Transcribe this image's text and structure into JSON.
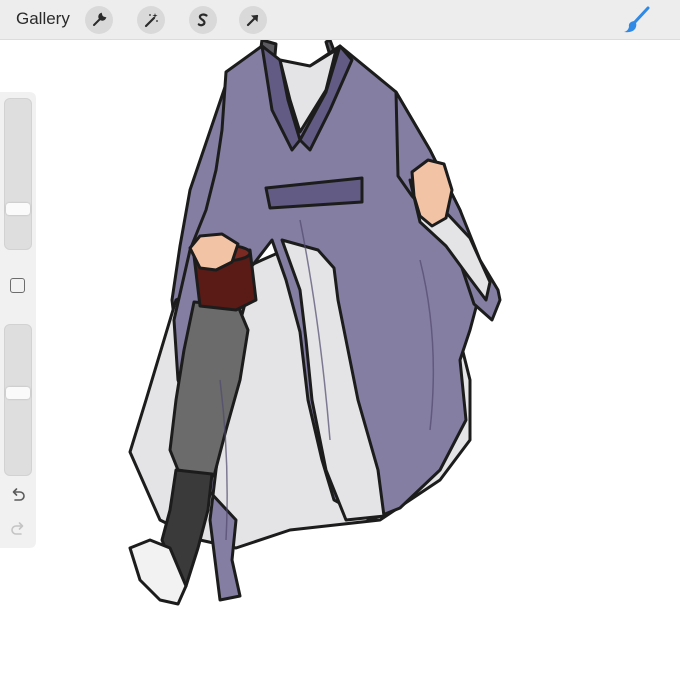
{
  "app": {
    "gallery_label": "Gallery"
  },
  "toolbar": {
    "left_tools": [
      {
        "name": "actions",
        "icon": "wrench-icon"
      },
      {
        "name": "adjustments",
        "icon": "magic-wand-icon"
      },
      {
        "name": "selection",
        "icon": "selection-s-icon"
      },
      {
        "name": "transform",
        "icon": "arrow-cursor-icon"
      }
    ],
    "right_tools": [
      {
        "name": "brush",
        "icon": "brush-icon",
        "active": true
      }
    ]
  },
  "sidebar": {
    "brush_size_level": 0.25,
    "opacity_level": 0.55,
    "items": [
      {
        "name": "brush-size-slider"
      },
      {
        "name": "modify-button",
        "icon": "square-icon"
      },
      {
        "name": "opacity-slider"
      },
      {
        "name": "undo-button",
        "icon": "undo-icon"
      },
      {
        "name": "redo-button",
        "icon": "redo-icon",
        "enabled": false
      }
    ]
  },
  "colors": {
    "accent": "#2f8ae6",
    "toolbar_bg": "#ededed",
    "robe": "#857ea3",
    "robe_shadow": "#625b83",
    "inner_robe": "#e4e4e6",
    "trousers": "#6b6b6b",
    "boot": "#3a3a3a",
    "cup": "#5a1a16",
    "skin": "#f3c3a6",
    "hair": "#5b5b60"
  }
}
